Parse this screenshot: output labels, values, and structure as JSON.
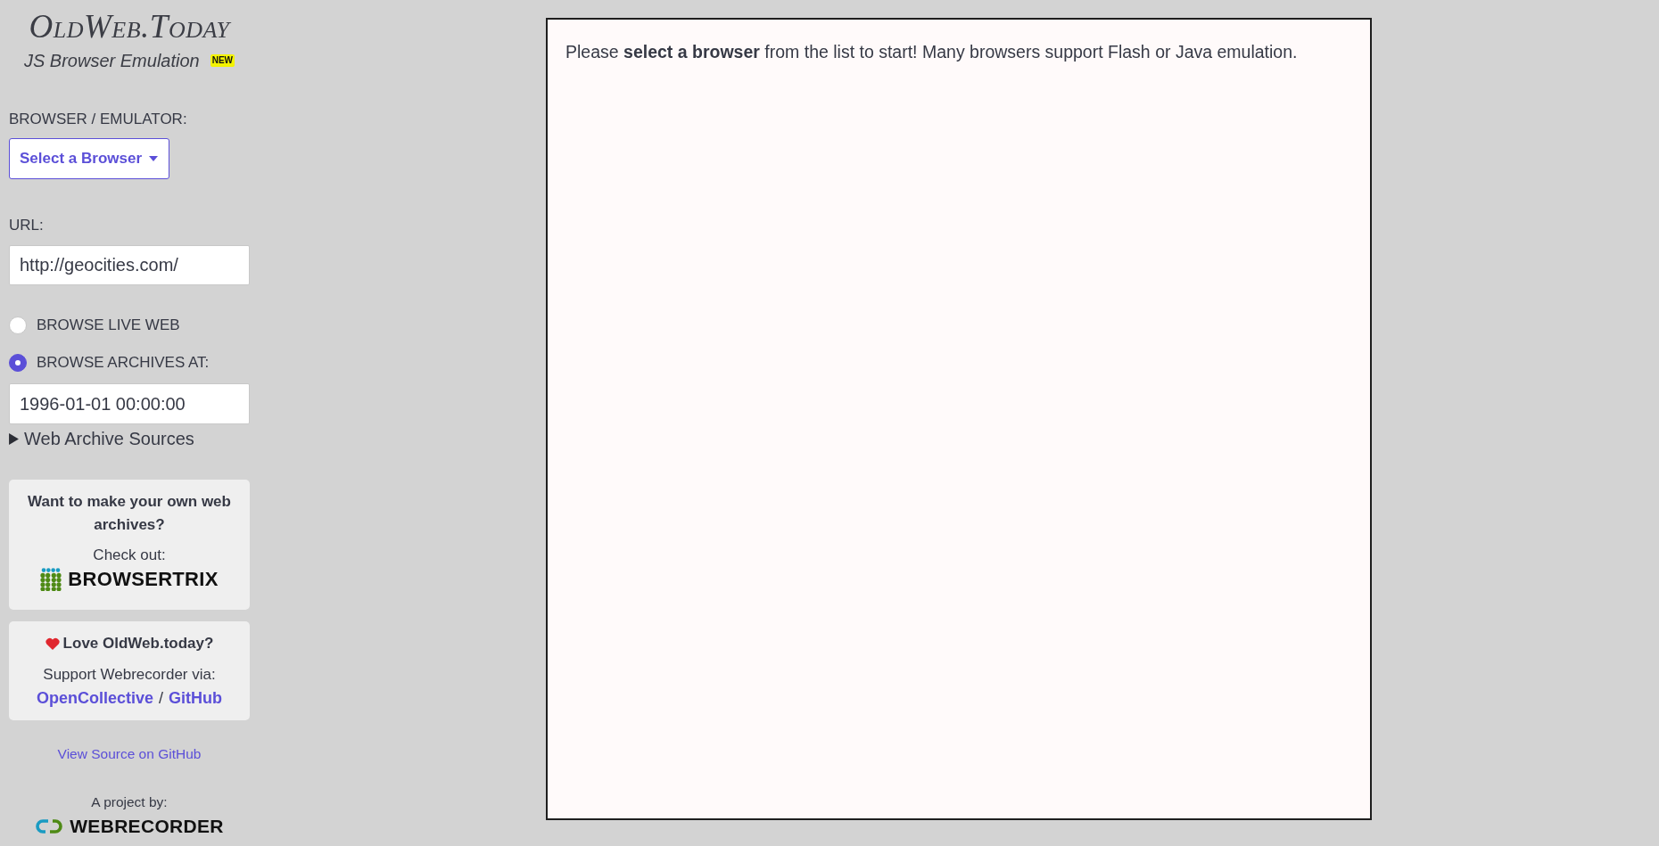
{
  "sidebar": {
    "logo": {
      "title": "OldWeb.Today",
      "subtitle": "JS Browser Emulation",
      "badge": "NEW"
    },
    "browser_label": "BROWSER / EMULATOR:",
    "browser_button": "Select a Browser",
    "url_label": "URL:",
    "url_value": "http://geocities.com/",
    "modes": [
      {
        "label": "BROWSE LIVE WEB",
        "selected": false
      },
      {
        "label": "BROWSE ARCHIVES AT:",
        "selected": true
      }
    ],
    "timestamp_value": "1996-01-01 00:00:00",
    "archive_sources": {
      "label": "Web Archive Sources",
      "expanded": false
    },
    "promo_card": {
      "heading": "Want to make your own web archives?",
      "text": "Check out:",
      "brand": "BROWSERTRIX"
    },
    "support_card": {
      "heading": "Love OldWeb.today?",
      "text": "Support Webrecorder via:",
      "links": [
        "OpenCollective",
        "GitHub"
      ],
      "separator": "/"
    },
    "source_link": "View Source on GitHub",
    "footer": {
      "text": "A project by:",
      "brand": "WEBRECORDER"
    }
  },
  "main": {
    "message": "Please **select a browser** from the list to start! Many browsers support Flash or Java emulation."
  }
}
